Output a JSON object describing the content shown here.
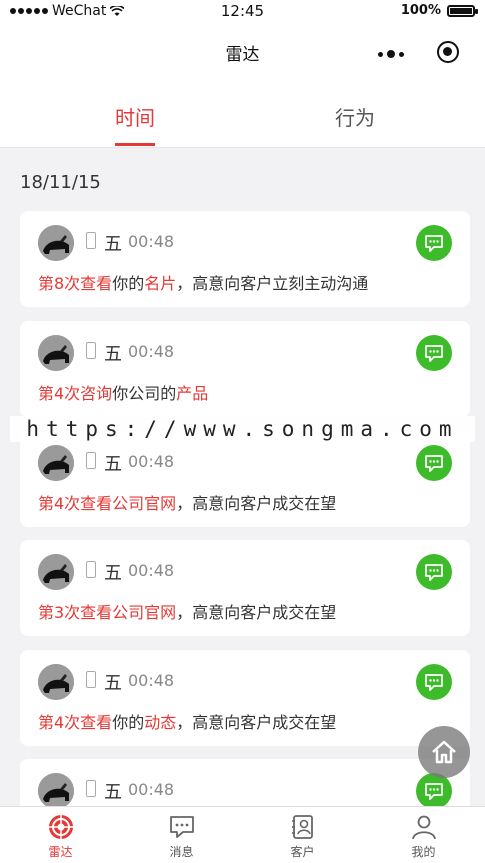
{
  "status": {
    "carrier": "WeChat",
    "time": "12:45",
    "battery": "100%"
  },
  "nav": {
    "title": "雷达"
  },
  "tabs": [
    {
      "label": "时间",
      "active": true
    },
    {
      "label": "行为",
      "active": false
    }
  ],
  "date": "18/11/15",
  "cards": [
    {
      "weekday": "五",
      "time": "00:48",
      "parts": [
        {
          "t": "第8次查看",
          "red": true
        },
        {
          "t": "你的",
          "red": false
        },
        {
          "t": "名片",
          "red": true
        },
        {
          "t": "，高意向客户立刻主动沟通",
          "red": false
        }
      ]
    },
    {
      "weekday": "五",
      "time": "00:48",
      "parts": [
        {
          "t": "第4次咨询",
          "red": true
        },
        {
          "t": "你公司的",
          "red": false
        },
        {
          "t": "产品",
          "red": true
        }
      ]
    },
    {
      "weekday": "五",
      "time": "00:48",
      "parts": [
        {
          "t": "第4次查看公司官网",
          "red": true
        },
        {
          "t": "，高意向客户成交在望",
          "red": false
        }
      ]
    },
    {
      "weekday": "五",
      "time": "00:48",
      "parts": [
        {
          "t": "第3次查看公司官网",
          "red": true
        },
        {
          "t": "，高意向客户成交在望",
          "red": false
        }
      ]
    },
    {
      "weekday": "五",
      "time": "00:48",
      "parts": [
        {
          "t": "第4次查看",
          "red": true
        },
        {
          "t": "你的",
          "red": false
        },
        {
          "t": "动态",
          "red": true
        },
        {
          "t": "，高意向客户成交在望",
          "red": false
        }
      ]
    },
    {
      "weekday": "五",
      "time": "00:48",
      "parts": []
    }
  ],
  "watermark": "https://www.songma.com",
  "tabbar": [
    {
      "label": "雷达",
      "icon": "radar-icon",
      "active": true
    },
    {
      "label": "消息",
      "icon": "message-icon",
      "active": false
    },
    {
      "label": "客户",
      "icon": "contacts-icon",
      "active": false
    },
    {
      "label": "我的",
      "icon": "profile-icon",
      "active": false
    }
  ],
  "colors": {
    "accent": "#e53935",
    "chat": "#3dbb2a"
  }
}
